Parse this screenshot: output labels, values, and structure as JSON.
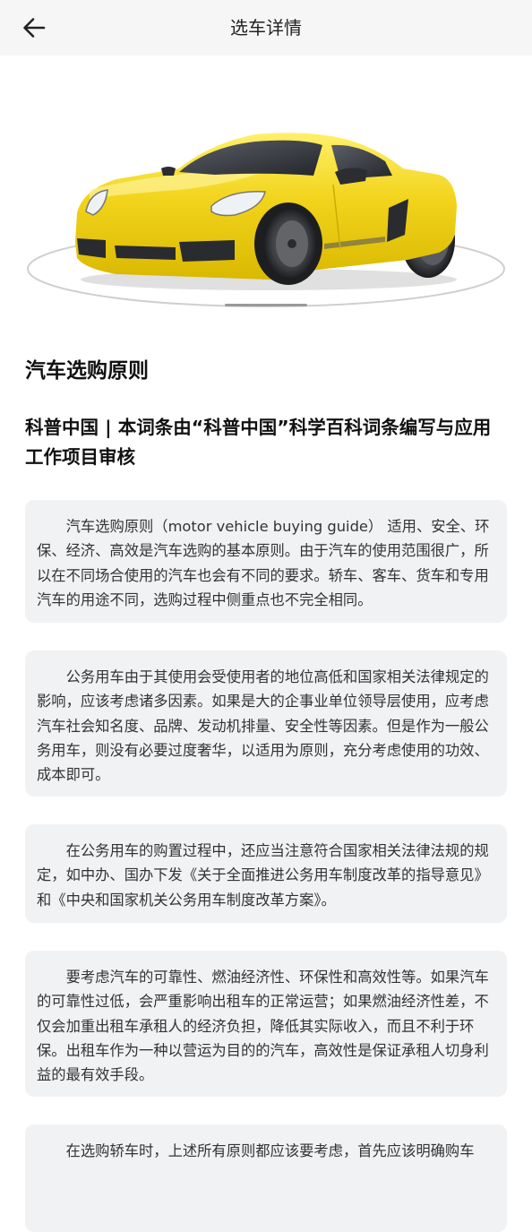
{
  "header": {
    "title": "选车详情"
  },
  "article": {
    "title": "汽车选购原则",
    "source": "科普中国 | 本词条由“科普中国”科学百科词条编写与应用工作项目审核",
    "paragraphs": [
      "汽车选购原则（motor vehicle buying guide） 适用、安全、环保、经济、高效是汽车选购的基本原则。由于汽车的使用范围很广，所以在不同场合使用的汽车也会有不同的要求。轿车、客车、货车和专用汽车的用途不同，选购过程中侧重点也不完全相同。",
      "公务用车由于其使用会受使用者的地位高低和国家相关法律规定的影响，应该考虑诸多因素。如果是大的企事业单位领导层使用，应考虑汽车社会知名度、品牌、发动机排量、安全性等因素。但是作为一般公务用车，则没有必要过度奢华，以适用为原则，充分考虑使用的功效、成本即可。",
      "在公务用车的购置过程中，还应当注意符合国家相关法律法规的规定，如中办、国办下发《关于全面推进公务用车制度改革的指导意见》和《中央和国家机关公务用车制度改革方案》。",
      "要考虑汽车的可靠性、燃油经济性、环保性和高效性等。如果汽车的可靠性过低，会严重影响出租车的正常运营；如果燃油经济性差，不仅会加重出租车承租人的经济负担，降低其实际收入，而且不利于环保。出租车作为一种以营运为目的的汽车，高效性是保证承租人切身利益的最有效手段。",
      "在选购轿车时，上述所有原则都应该要考虑，首先应该明确购车"
    ]
  },
  "colors": {
    "car_body": "#f2d41c",
    "card_background": "#f1f2f4",
    "header_background": "#f6f6f6"
  },
  "icons": {
    "back": "arrow-left-icon"
  }
}
